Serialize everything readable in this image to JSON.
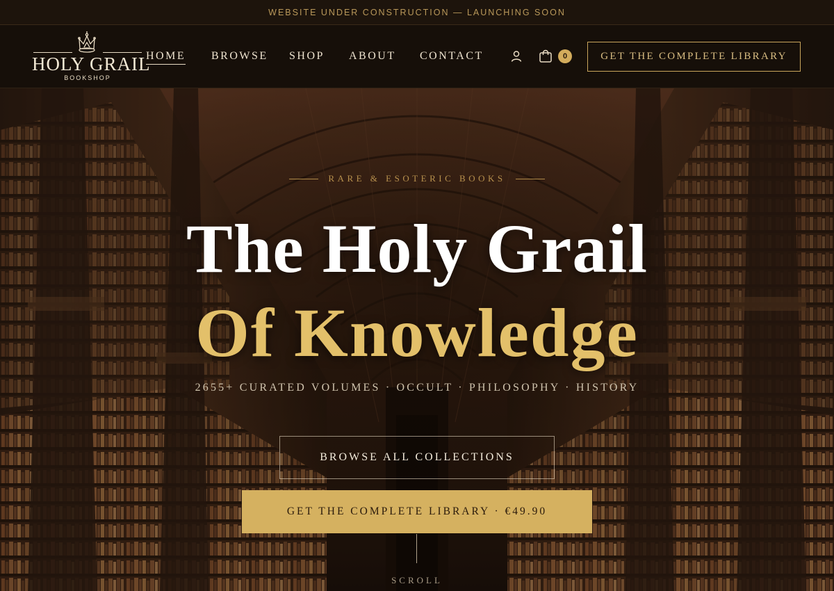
{
  "announcement": {
    "text": "WEBSITE UNDER CONSTRUCTION — LAUNCHING SOON"
  },
  "header": {
    "logo": {
      "name": "HOLY GRAIL",
      "sub": "BOOKSHOP",
      "icon": "crown-icon"
    },
    "nav": [
      {
        "label": "HOME",
        "active": true
      },
      {
        "label": "BROWSE",
        "active": false
      },
      {
        "label": "SHOP",
        "active": false
      },
      {
        "label": "ABOUT",
        "active": false
      },
      {
        "label": "CONTACT",
        "active": false
      }
    ],
    "user_icon": "user-icon",
    "cart": {
      "icon": "cart-icon",
      "count": "0"
    },
    "cta_label": "GET THE COMPLETE LIBRARY"
  },
  "hero": {
    "eyebrow": "RARE & ESOTERIC BOOKS",
    "title_line1": "The Holy Grail",
    "title_line2": "Of Knowledge",
    "tagline": "2655+ CURATED VOLUMES · OCCULT · PHILOSOPHY · HISTORY",
    "browse_label": "BROWSE ALL COLLECTIONS",
    "buy_label": "GET THE COMPLETE LIBRARY · €49.90",
    "scroll_label": "SCROLL"
  },
  "colors": {
    "accent_gold": "#d5b160",
    "title_gold": "#e3c06a",
    "background": "#160f09"
  }
}
